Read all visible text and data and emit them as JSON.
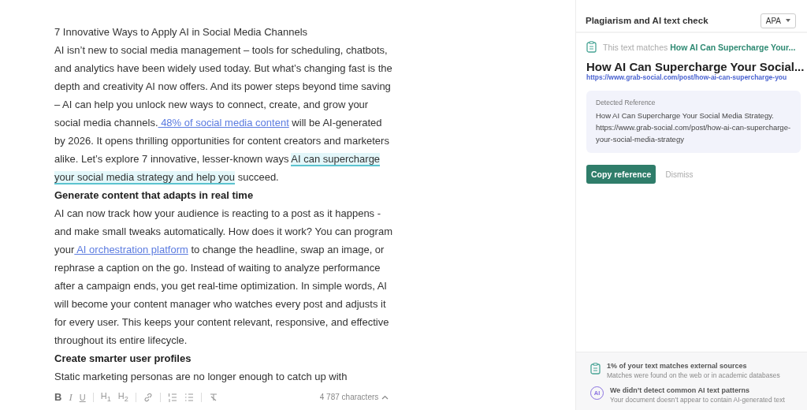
{
  "document": {
    "paragraphs": [
      {
        "kind": "title",
        "segments": [
          {
            "kind": "text",
            "text": "7 Innovative Ways to Apply AI in Social Media Channels"
          }
        ]
      },
      {
        "kind": "body",
        "segments": [
          {
            "kind": "text",
            "text": "AI isn’t new to social media management – tools for scheduling, chatbots, and analytics have been widely used today. But what’s changing fast is the depth and creativity AI now offers. And its power steps beyond time saving – AI can help you unlock new ways to connect, create, and grow your social media channels."
          },
          {
            "kind": "link",
            "text": " 48% of social media content"
          },
          {
            "kind": "text",
            "text": " will be AI-generated by 2026. It opens thrilling opportunities for content creators and marketers alike. Let’s explore 7 innovative, lesser-known ways "
          },
          {
            "kind": "highlight",
            "text": "AI can supercharge your social media strategy and help you"
          },
          {
            "kind": "text",
            "text": " succeed."
          }
        ]
      },
      {
        "kind": "heading",
        "segments": [
          {
            "kind": "text",
            "text": "Generate content that adapts in real time"
          }
        ]
      },
      {
        "kind": "body",
        "segments": [
          {
            "kind": "text",
            "text": "AI can now track how your audience is reacting to a post as it happens - and make small tweaks automatically. How does it work? You can program your"
          },
          {
            "kind": "link",
            "text": " AI orchestration platform"
          },
          {
            "kind": "text",
            "text": " to change the headline, swap an image, or rephrase a caption on the go. Instead of waiting to analyze performance after a campaign ends, you get real-time optimization. In simple words, AI will become your content manager who watches every post and adjusts it for every user. This keeps your content relevant, responsive, and effective throughout its entire lifecycle."
          }
        ]
      },
      {
        "kind": "heading",
        "segments": [
          {
            "kind": "text",
            "text": "Create smarter user profiles"
          }
        ]
      },
      {
        "kind": "body",
        "segments": [
          {
            "kind": "text",
            "text": "Static marketing personas are no longer enough to catch up with"
          }
        ]
      }
    ]
  },
  "toolbar": {
    "tools": [
      {
        "kind": "text",
        "label": "B"
      },
      {
        "kind": "text",
        "label": "I"
      },
      {
        "kind": "text",
        "label": "U"
      },
      {
        "kind": "divider"
      },
      {
        "kind": "text",
        "label": "H$_{1}$"
      },
      {
        "kind": "text",
        "label": "H$_{2}$"
      },
      {
        "kind": "divider"
      },
      {
        "kind": "link"
      },
      {
        "kind": "divider"
      },
      {
        "kind": "ordered-list"
      },
      {
        "kind": "bullet-list"
      },
      {
        "kind": "divider"
      },
      {
        "kind": "clear-format"
      }
    ],
    "character_count": "4 787 characters"
  },
  "panel": {
    "title": "Plagiarism and AI text check",
    "citation_style": "APA",
    "match_prefix": "This text matches ",
    "match_title": "How AI Can Supercharge Your...",
    "source_title": "How AI Can Supercharge Your Social...",
    "source_url": "https://www.grab-social.com/post/how-ai-can-supercharge-you",
    "reference_label": "Detected Reference",
    "reference_text": "How AI Can Supercharge Your Social Media Strategy. https://www.grab-social.com/post/how-ai-can-supercharge-your-social-media-strategy",
    "primary_button": "Copy reference",
    "secondary_button": "Dismiss",
    "summary": [
      {
        "kind": "plagiarism",
        "title": "1% of your text matches external sources",
        "detail": "Matches were found on the web or in academic databases"
      },
      {
        "kind": "ai",
        "title": "We didn’t detect common AI text patterns",
        "detail": "Your document doesn’t appear to contain AI-generated text",
        "icon_text": "AI"
      }
    ]
  }
}
